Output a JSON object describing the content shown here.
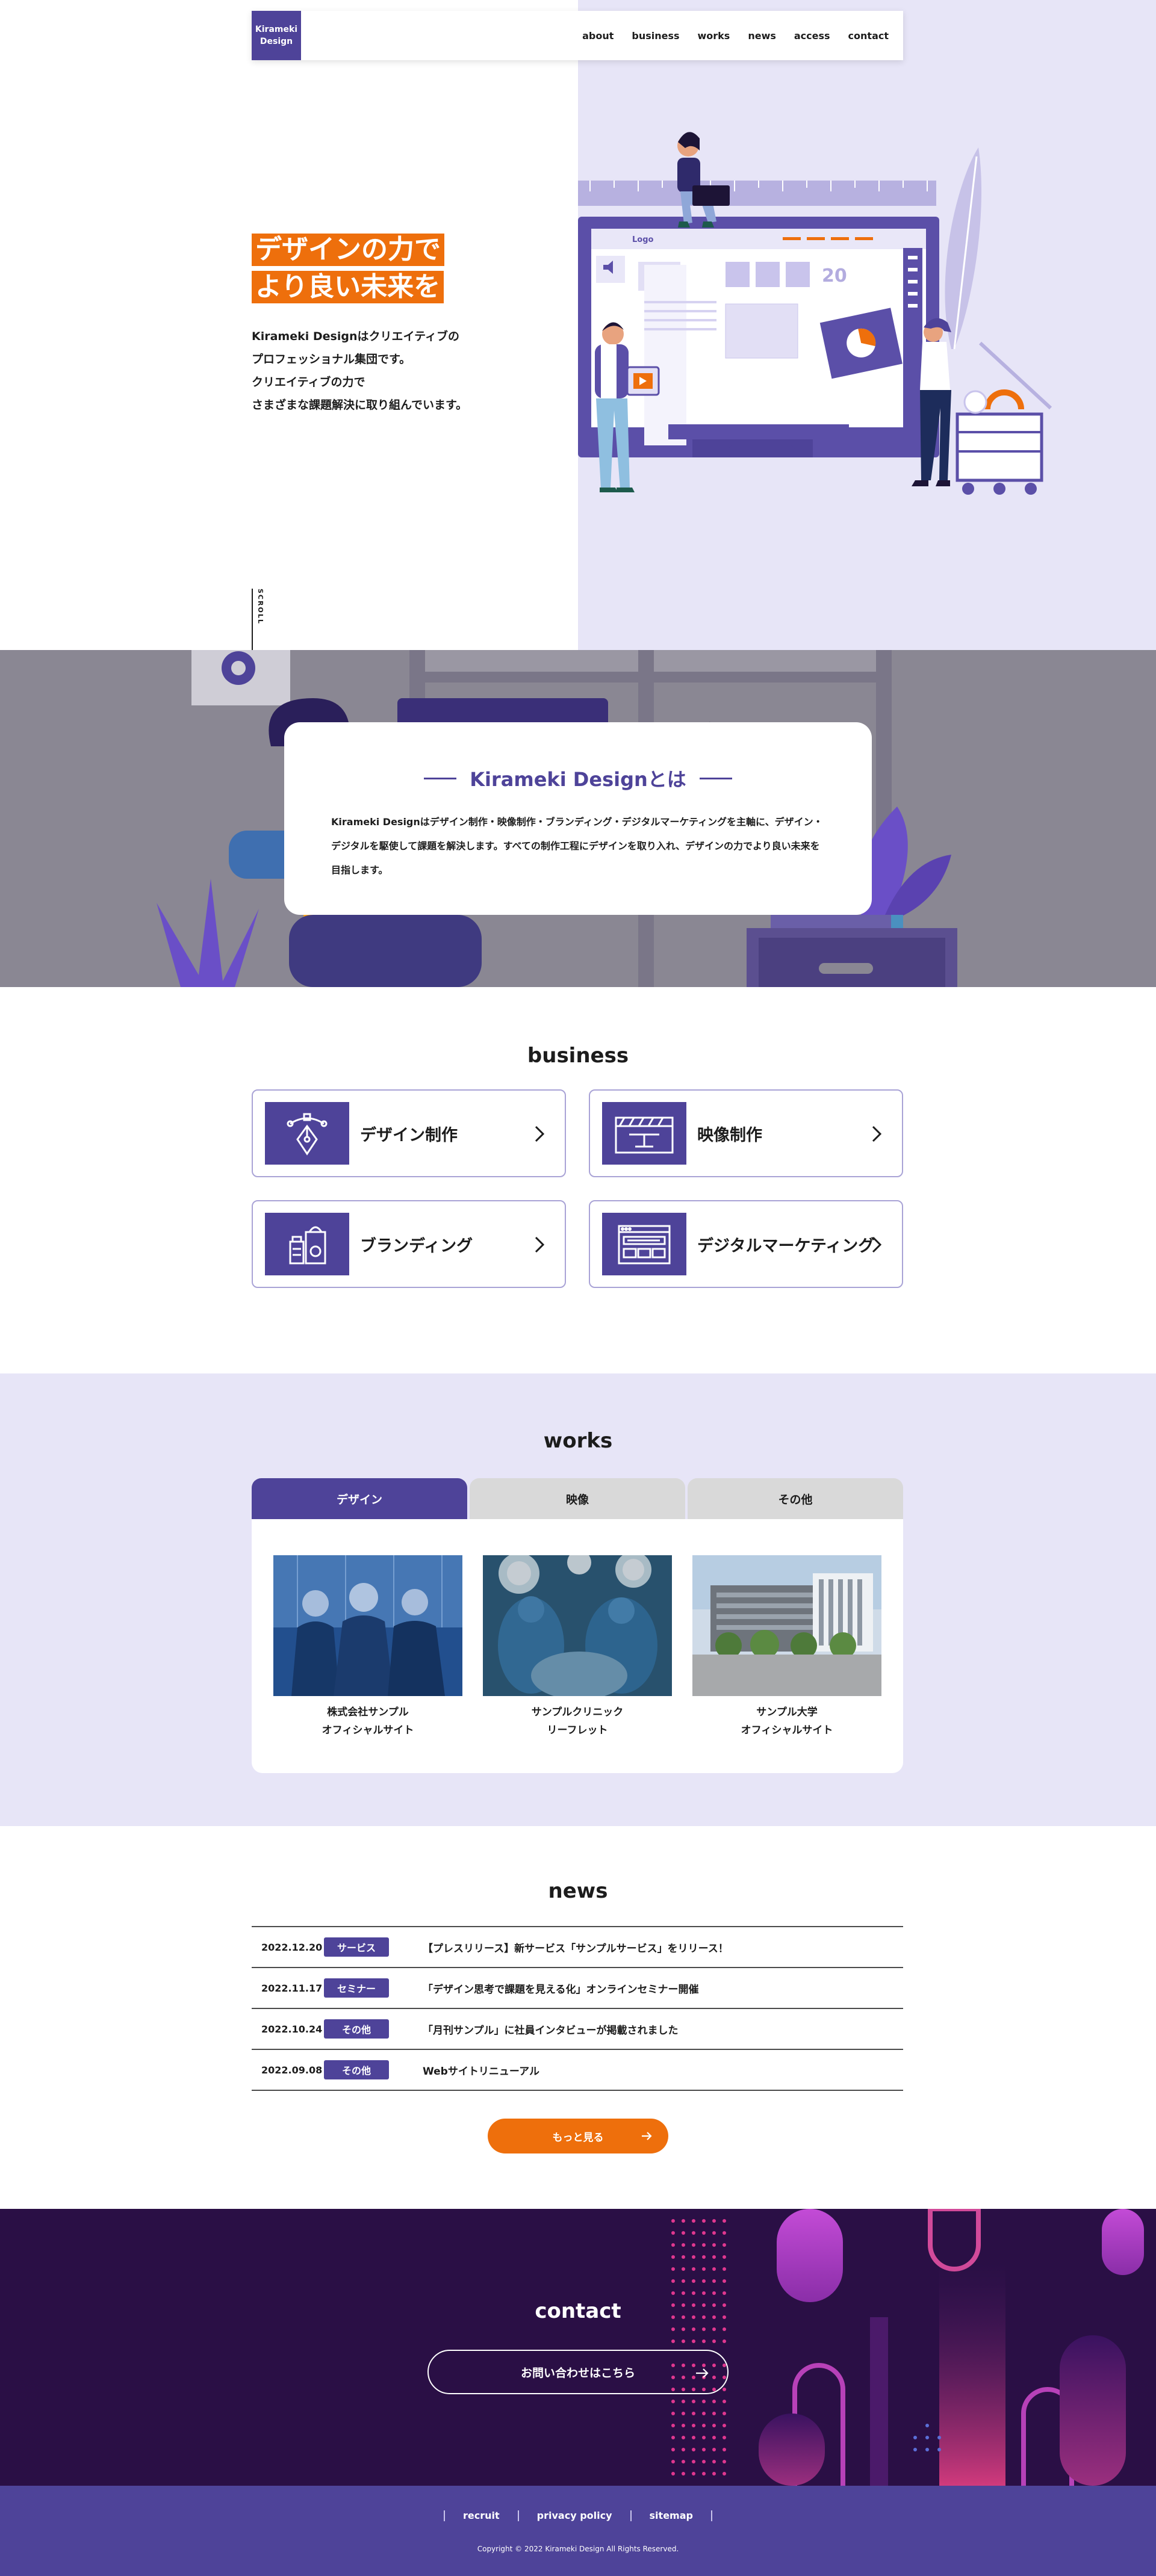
{
  "header": {
    "logo_line1": "Kirameki",
    "logo_line2": "Design",
    "nav": [
      "about",
      "business",
      "works",
      "news",
      "access",
      "contact"
    ]
  },
  "hero": {
    "catch_line1": "デザインの力で",
    "catch_line2": "より良い未来を",
    "desc_lines": [
      "Kirameki Designはクリエイティブの",
      "プロフェッショナル集団です。",
      "クリエイティブの力で",
      "さまざまな課題解決に取り組んでいます。"
    ],
    "scroll_label": "SCROLL",
    "illustration_screen_logo": "Logo",
    "illustration_percent": "20"
  },
  "about": {
    "title": "Kirameki Designとは",
    "text": "Kirameki Designはデザイン制作・映像制作・ブランディング・デジタルマーケティングを主軸に、デザイン・デジタルを駆使して課題を解決します。すべての制作工程にデザインを取り入れ、デザインの力でより良い未来を目指します。"
  },
  "business": {
    "title": "business",
    "items": [
      {
        "label": "デザイン制作",
        "icon": "pen-tool-icon"
      },
      {
        "label": "映像制作",
        "icon": "clapperboard-icon"
      },
      {
        "label": "ブランディング",
        "icon": "products-icon"
      },
      {
        "label": "デジタルマーケティング",
        "icon": "web-layout-icon"
      }
    ]
  },
  "works": {
    "title": "works",
    "tabs": [
      "デザイン",
      "映像",
      "その他"
    ],
    "active_tab": 0,
    "items": [
      {
        "caption_line1": "株式会社サンプル",
        "caption_line2": "オフィシャルサイト",
        "image": "business-people-photo"
      },
      {
        "caption_line1": "サンプルクリニック",
        "caption_line2": "リーフレット",
        "image": "surgery-photo"
      },
      {
        "caption_line1": "サンプル大学",
        "caption_line2": "オフィシャルサイト",
        "image": "university-building-photo"
      }
    ]
  },
  "news": {
    "title": "news",
    "items": [
      {
        "date": "2022.12.20",
        "category": "サービス",
        "title": "【プレスリリース】新サービス「サンプルサービス」をリリース！"
      },
      {
        "date": "2022.11.17",
        "category": "セミナー",
        "title": "「デザイン思考で課題を見える化」オンラインセミナー開催"
      },
      {
        "date": "2022.10.24",
        "category": "その他",
        "title": "「月刊サンプル」に社員インタビューが掲載されました"
      },
      {
        "date": "2022.09.08",
        "category": "その他",
        "title": "Webサイトリニューアル"
      }
    ],
    "more_label": "もっと見る"
  },
  "contact": {
    "title": "contact",
    "button_label": "お問い合わせはこちら"
  },
  "footer": {
    "links": [
      "recruit",
      "privacy policy",
      "sitemap"
    ],
    "copyright": "Copyright © 2022 Kirameki Design All Rights Reserved."
  },
  "colors": {
    "brand_purple": "#4e4399",
    "accent_orange": "#ee6f0c",
    "lavender_bg": "#e7e5f7",
    "contact_bg": "#2a0f45"
  }
}
